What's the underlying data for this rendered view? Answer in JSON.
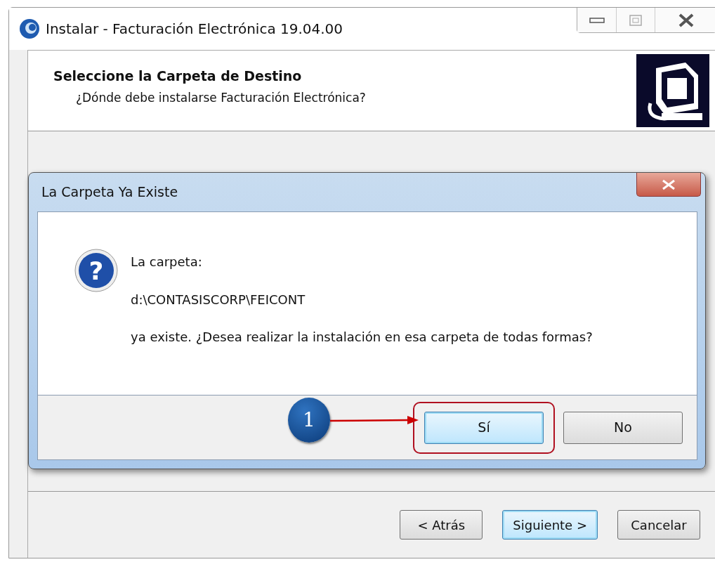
{
  "window": {
    "title": "Instalar - Facturación Electrónica 19.04.00"
  },
  "header": {
    "title": "Seleccione la Carpeta de Destino",
    "subtitle": "¿Dónde debe instalarse Facturación Electrónica?"
  },
  "dialog": {
    "title": "La Carpeta Ya Existe",
    "icon_glyph": "?",
    "message": [
      "La carpeta:",
      "d:\\CONTASISCORP\\FEICONT",
      "ya existe. ¿Desea realizar la instalación en esa carpeta de todas formas?"
    ],
    "buttons": [
      {
        "label": "Sí",
        "default": true
      },
      {
        "label": "No",
        "default": false
      }
    ]
  },
  "annotation": {
    "label": "1"
  },
  "buttons": [
    {
      "label": "< Atrás",
      "default": false
    },
    {
      "label": "Siguiente >",
      "default": true
    },
    {
      "label": "Cancelar",
      "default": false
    }
  ]
}
